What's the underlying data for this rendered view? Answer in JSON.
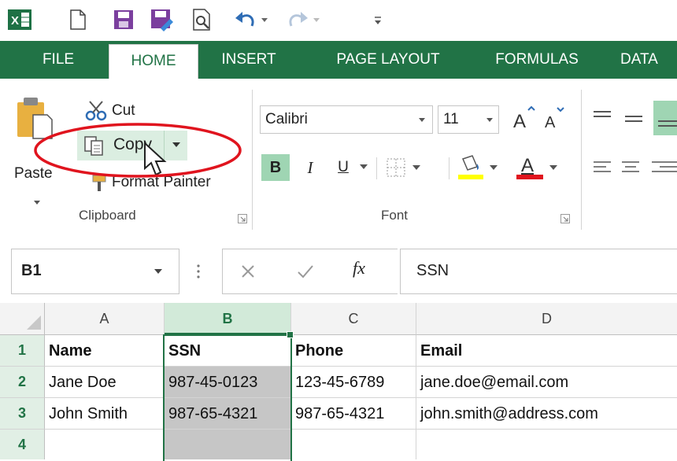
{
  "qat": {
    "icons": [
      "excel-logo-icon",
      "new-document-icon",
      "save-icon",
      "save-as-icon",
      "print-preview-icon",
      "undo-icon",
      "redo-icon",
      "customize-qat-icon"
    ]
  },
  "tabs": [
    {
      "label": "FILE"
    },
    {
      "label": "HOME"
    },
    {
      "label": "INSERT"
    },
    {
      "label": "PAGE LAYOUT"
    },
    {
      "label": "FORMULAS"
    },
    {
      "label": "DATA"
    }
  ],
  "clipboard": {
    "paste_label": "Paste",
    "cut_label": "Cut",
    "copy_label": "Copy",
    "format_painter_label": "Format Painter",
    "group_label": "Clipboard"
  },
  "font": {
    "font_name": "Calibri",
    "font_size": "11",
    "bold": "B",
    "italic": "I",
    "underline": "U",
    "group_label": "Font"
  },
  "formula_bar": {
    "name_box": "B1",
    "function_icon": "fx",
    "content": "SSN"
  },
  "sheet": {
    "columns": [
      "A",
      "B",
      "C",
      "D"
    ],
    "selected_column": "B",
    "rows": [
      {
        "num": "1",
        "cells": [
          "Name",
          "SSN",
          "Phone",
          "Email"
        ]
      },
      {
        "num": "2",
        "cells": [
          "Jane Doe",
          "987-45-0123",
          "123-45-6789",
          "jane.doe@email.com"
        ]
      },
      {
        "num": "3",
        "cells": [
          "John Smith",
          "987-65-4321",
          "987-65-4321",
          "john.smith@address.com"
        ]
      },
      {
        "num": "4",
        "cells": [
          "",
          "",
          "",
          ""
        ]
      }
    ]
  },
  "colors": {
    "excel_green": "#217346",
    "annotation_red": "#e0141e",
    "selection_gray": "#c6c6c6"
  }
}
